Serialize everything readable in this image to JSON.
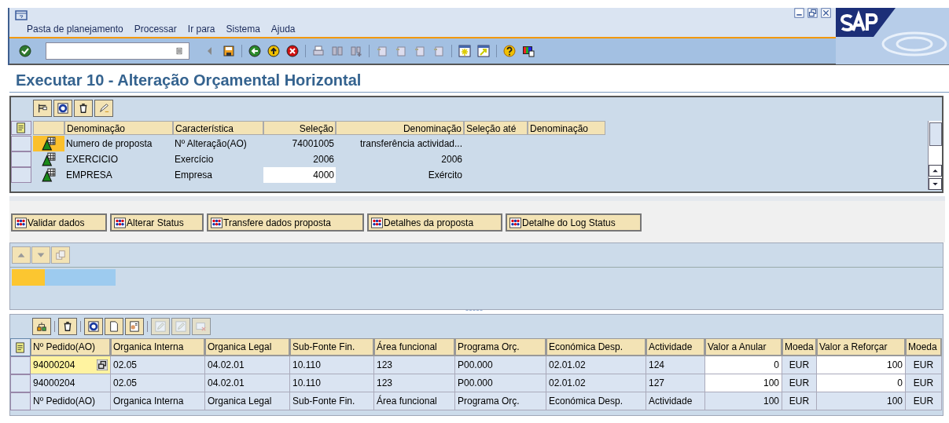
{
  "menu": [
    "Pasta de planejamento",
    "Processar",
    "Ir para",
    "Sistema",
    "Ajuda"
  ],
  "title": "Executar 10 - Alteração Orçamental Horizontal",
  "selection": {
    "columns": [
      "Denominação",
      "Característica",
      "Seleção",
      "Denominação",
      "Seleção até",
      "Denominação"
    ],
    "rows": [
      {
        "selected": true,
        "editable": false,
        "cells": [
          "Numero de proposta",
          "Nº Alteração(AO)",
          "74001005",
          "transferência actividad..."
        ]
      },
      {
        "selected": false,
        "editable": false,
        "cells": [
          "EXERCICIO",
          "Exercício",
          "2006",
          "2006"
        ]
      },
      {
        "selected": false,
        "editable": true,
        "cells": [
          "EMPRESA",
          "Empresa",
          "4000",
          "Exército"
        ]
      }
    ]
  },
  "buttons": [
    "Validar dados",
    "Alterar Status",
    "Transfere dados proposta",
    "Detalhes da proposta",
    "Detalhe do Log Status"
  ],
  "grid": {
    "columns": [
      {
        "label": "Nº Pedido(AO)",
        "kind": "text"
      },
      {
        "label": "Organica Interna",
        "kind": "text"
      },
      {
        "label": "Organica Legal",
        "kind": "text"
      },
      {
        "label": "Sub-Fonte Fin.",
        "kind": "text"
      },
      {
        "label": "Área funcional",
        "kind": "text"
      },
      {
        "label": "Programa Orç.",
        "kind": "text"
      },
      {
        "label": "Económica Desp.",
        "kind": "text"
      },
      {
        "label": "Actividade",
        "kind": "text"
      },
      {
        "label": "Valor a Anular",
        "kind": "amount"
      },
      {
        "label": "Moeda",
        "kind": "currency"
      },
      {
        "label": "Valor a Reforçar",
        "kind": "amount"
      },
      {
        "label": "Moeda",
        "kind": "currency"
      }
    ],
    "rows": [
      {
        "focused": true,
        "editable": true,
        "cells": [
          "94000204",
          "02.05",
          "04.02.01",
          "10.110",
          "123",
          "P00.000",
          "02.01.02",
          "124",
          "0",
          "EUR",
          "100",
          "EUR"
        ]
      },
      {
        "focused": false,
        "editable": true,
        "cells": [
          "94000204",
          "02.05",
          "04.02.01",
          "10.110",
          "123",
          "P00.000",
          "02.01.02",
          "127",
          "100",
          "EUR",
          "0",
          "EUR"
        ]
      },
      {
        "focused": false,
        "editable": false,
        "cells": [
          "Nº Pedido(AO)",
          "Organica Interna",
          "Organica Legal",
          "Sub-Fonte Fin.",
          "Área funcional",
          "Programa Orç.",
          "Económica Desp.",
          "Actividade",
          "100",
          "EUR",
          "100",
          "EUR"
        ]
      }
    ]
  }
}
